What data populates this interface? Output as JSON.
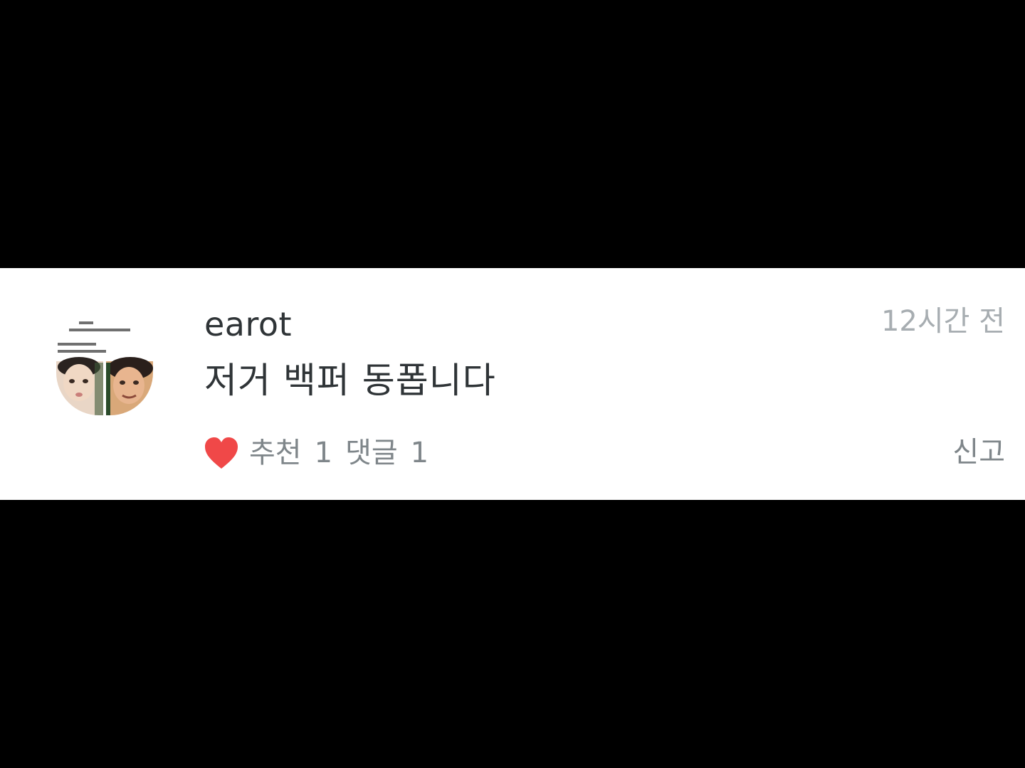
{
  "comment": {
    "username": "earot",
    "timestamp": "12시간 전",
    "body": "저거 백퍼 동폽니다",
    "likes": {
      "label": "추천",
      "count": "1",
      "icon": "heart-icon",
      "color": "#f04848"
    },
    "replies": {
      "label": "댓글",
      "count": "1"
    },
    "report_label": "신고"
  },
  "colors": {
    "background": "#000000",
    "card": "#ffffff",
    "primary_text": "#2f3437",
    "secondary_text": "#7f868a",
    "timestamp_text": "#a7adb1"
  }
}
